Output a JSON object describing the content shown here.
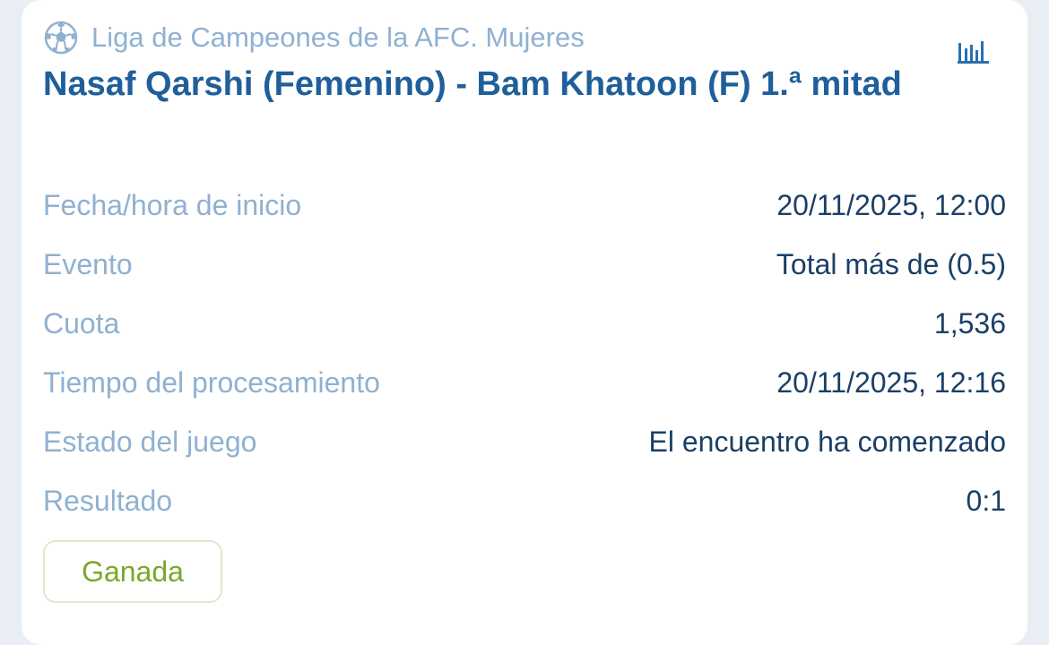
{
  "league": {
    "icon": "soccer-ball-icon",
    "name": "Liga de Campeones de la AFC. Mujeres"
  },
  "stats_icon": "bar-chart-icon",
  "match": {
    "title": "Nasaf Qarshi (Femenino) - Bam Khatoon (F) 1.ª mitad"
  },
  "details": [
    {
      "label": "Fecha/hora de inicio",
      "value": "20/11/2025, 12:00"
    },
    {
      "label": "Evento",
      "value": "Total más de (0.5)"
    },
    {
      "label": "Cuota",
      "value": "1,536"
    },
    {
      "label": "Tiempo del procesamiento",
      "value": "20/11/2025, 12:16"
    },
    {
      "label": "Estado del juego",
      "value": "El encuentro ha comenzado"
    },
    {
      "label": "Resultado",
      "value": "0:1"
    }
  ],
  "status": {
    "label": "Ganada",
    "color": "#7aa828"
  },
  "colors": {
    "title": "#1f5f9a",
    "label": "#8fb1d1",
    "value": "#1b3f66",
    "background": "#e9eef4"
  }
}
